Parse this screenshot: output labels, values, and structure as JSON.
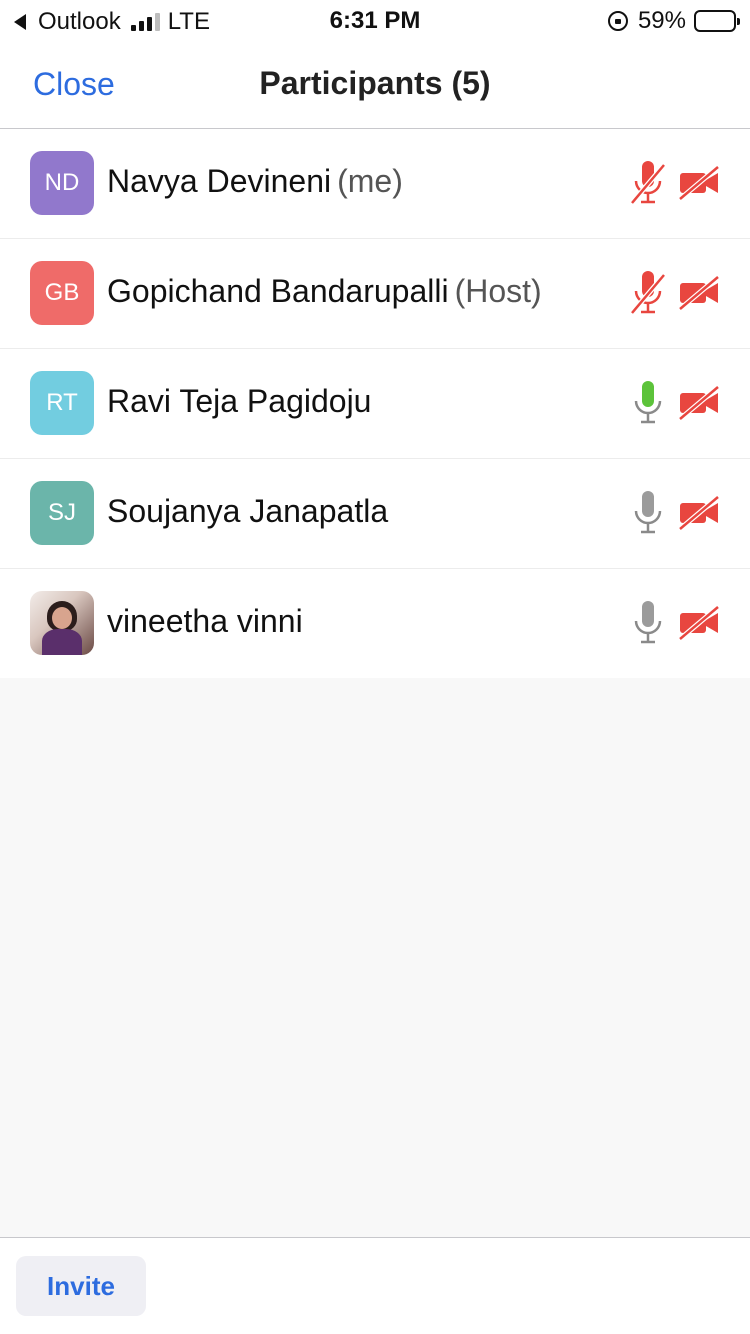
{
  "status_bar": {
    "carrier": "Outlook",
    "network": "LTE",
    "time": "6:31 PM",
    "battery": "59%",
    "battery_level": 0.59
  },
  "header": {
    "close_label": "Close",
    "title": "Participants (5)"
  },
  "participants": [
    {
      "initials": "ND",
      "name": "Navya Devineni",
      "role": "(me)",
      "avatar_color": "#9178cc",
      "mic": "muted",
      "video": "off"
    },
    {
      "initials": "GB",
      "name": "Gopichand Bandarupalli",
      "role": "(Host)",
      "avatar_color": "#ef6b69",
      "mic": "muted",
      "video": "off"
    },
    {
      "initials": "RT",
      "name": "Ravi Teja Pagidoju",
      "role": "",
      "avatar_color": "#72cde0",
      "mic": "speaking",
      "video": "off"
    },
    {
      "initials": "SJ",
      "name": "Soujanya Janapatla",
      "role": "",
      "avatar_color": "#6bb5aa",
      "mic": "on",
      "video": "off"
    },
    {
      "initials": "",
      "name": "vineetha vinni",
      "role": "",
      "avatar_color": "photo",
      "mic": "on",
      "video": "off"
    }
  ],
  "icons": {
    "mic_muted": "mic-muted-icon",
    "mic_speaking": "mic-active-icon",
    "mic_on": "mic-icon",
    "video_off": "video-off-icon"
  },
  "colors": {
    "accent": "#2d6cdf",
    "muted_red": "#e8463f",
    "speaking_green": "#5cc33a",
    "mic_gray": "#9b9b9b"
  },
  "footer": {
    "invite_label": "Invite"
  }
}
